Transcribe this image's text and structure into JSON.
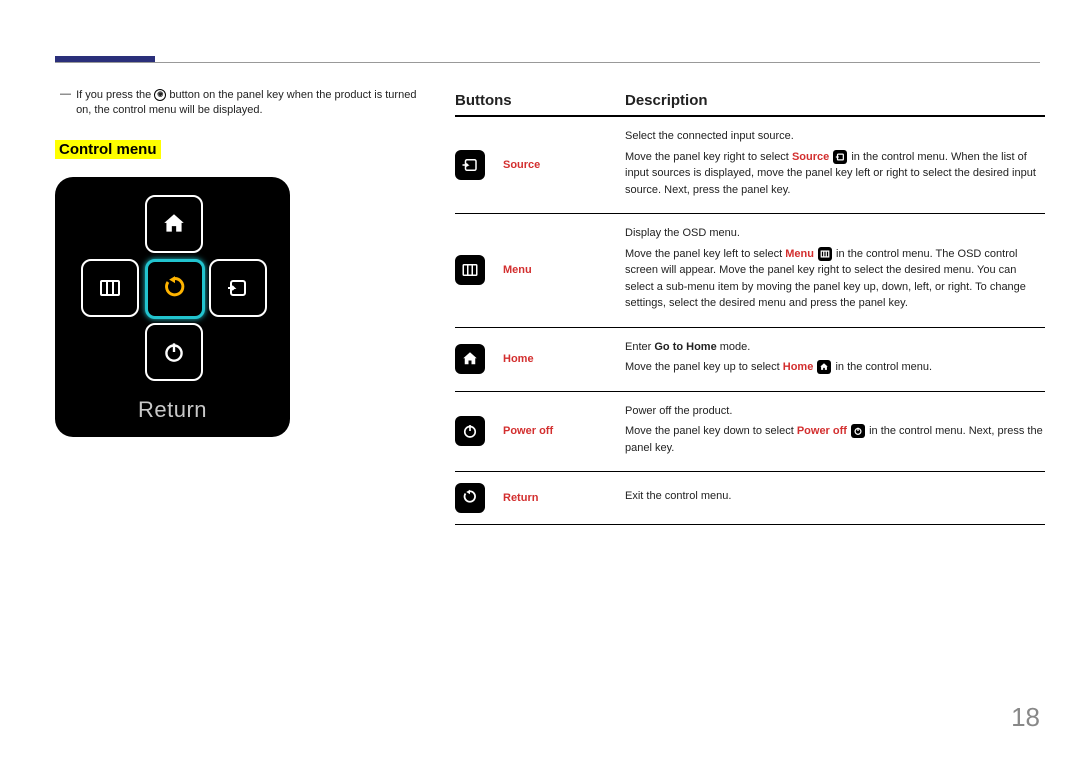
{
  "note_dash": "―",
  "note_before": "If you press the ",
  "note_btn": "◎",
  "note_after": " button on the panel key when the product is turned on, the control menu will be displayed.",
  "control_menu_title": "Control menu",
  "panel_return": "Return",
  "header_buttons": "Buttons",
  "header_description": "Description",
  "rows": [
    {
      "label": "Source",
      "p1": "Select the connected input source.",
      "p2a": "Move the panel key right to select ",
      "p2b": "Source",
      "p2c": " in the control menu. When the list of input sources is displayed, move the panel key left or right to select the desired input source. Next, press the panel key."
    },
    {
      "label": "Menu",
      "p1": "Display the OSD menu.",
      "p2a": "Move the panel key left to select ",
      "p2b": "Menu",
      "p2c": " in the control menu. The OSD control screen will appear. Move the panel key right to select the desired menu. You can select a sub-menu item by moving the panel key up, down, left, or right. To change settings, select the desired menu and press the panel key."
    },
    {
      "label": "Home",
      "p1a": "Enter ",
      "p1b": "Go to Home",
      "p1c": " mode.",
      "p2a": "Move the panel key up to select ",
      "p2b": "Home",
      "p2c": " in the control menu."
    },
    {
      "label": "Power off",
      "p1": "Power off the product.",
      "p2a": "Move the panel key down to select ",
      "p2b": "Power off",
      "p2c": " in the control menu. Next, press the panel key."
    },
    {
      "label": "Return",
      "p1": "Exit the control menu."
    }
  ],
  "page_number": "18"
}
